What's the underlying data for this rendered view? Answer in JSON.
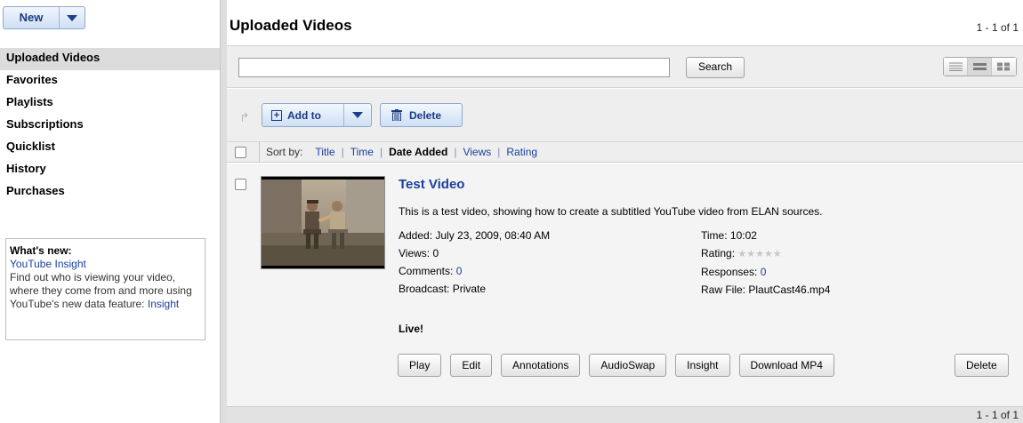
{
  "toolbar": {
    "new_label": "New"
  },
  "sidebar": {
    "items": [
      {
        "label": "Uploaded Videos",
        "active": true
      },
      {
        "label": "Favorites"
      },
      {
        "label": "Playlists"
      },
      {
        "label": "Subscriptions"
      },
      {
        "label": "Quicklist"
      },
      {
        "label": "History"
      },
      {
        "label": "Purchases"
      }
    ],
    "whats_new": {
      "title": "What's new:",
      "link": "YouTube Insight",
      "text": "Find out who is viewing your video, where they come from and more using YouTube's new data feature: ",
      "link2": "Insight"
    }
  },
  "main": {
    "title": "Uploaded Videos",
    "pager": "1 - 1 of 1",
    "search": {
      "value": "",
      "button": "Search"
    },
    "actions": {
      "add_to": "Add to",
      "delete": "Delete"
    },
    "sort": {
      "label": "Sort by:",
      "options": [
        "Title",
        "Time",
        "Date Added",
        "Views",
        "Rating"
      ],
      "current": "Date Added"
    },
    "video": {
      "title": "Test Video",
      "description": "This is a test video, showing how to create a subtitled YouTube video from ELAN sources.",
      "added_label": "Added: ",
      "added": "July 23, 2009, 08:40 AM",
      "views_label": "Views: ",
      "views": "0",
      "comments_label": "Comments: ",
      "comments": "0",
      "broadcast_label": "Broadcast: ",
      "broadcast": "Private",
      "time_label": "Time: ",
      "time": "10:02",
      "rating_label": "Rating: ",
      "rating_stars": "★★★★★",
      "responses_label": "Responses: ",
      "responses": "0",
      "rawfile_label": "Raw File: ",
      "rawfile": "PlautCast46.mp4",
      "status": "Live!",
      "buttons": {
        "play": "Play",
        "edit": "Edit",
        "annotations": "Annotations",
        "audioswap": "AudioSwap",
        "insight": "Insight",
        "download": "Download MP4",
        "delete": "Delete"
      }
    }
  },
  "colors": {
    "link": "#1a3f9f",
    "panel": "#eeeeee",
    "button_blue": "#cfdff4"
  }
}
